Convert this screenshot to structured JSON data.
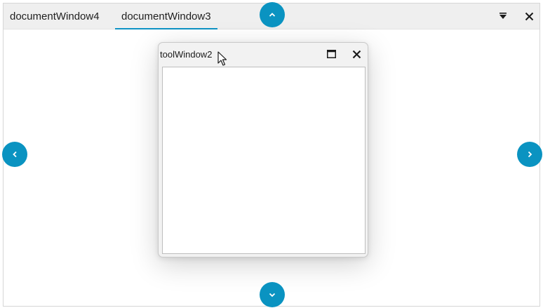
{
  "tabs": [
    {
      "label": "documentWindow4",
      "active": false
    },
    {
      "label": "documentWindow3",
      "active": true
    }
  ],
  "tabstrip_buttons": [
    {
      "name": "dropdown-menu-icon"
    },
    {
      "name": "close-icon"
    }
  ],
  "floating_window": {
    "title": "toolWindow2",
    "buttons": [
      {
        "name": "maximize-icon"
      },
      {
        "name": "close-icon"
      }
    ]
  },
  "nav_buttons": {
    "top": "chevron-up-icon",
    "bottom": "chevron-down-icon",
    "left": "chevron-left-icon",
    "right": "chevron-right-icon"
  },
  "colors": {
    "accent": "#0a93c1",
    "tabstrip_bg": "#efefef",
    "active_underline": "#0f93c4"
  }
}
